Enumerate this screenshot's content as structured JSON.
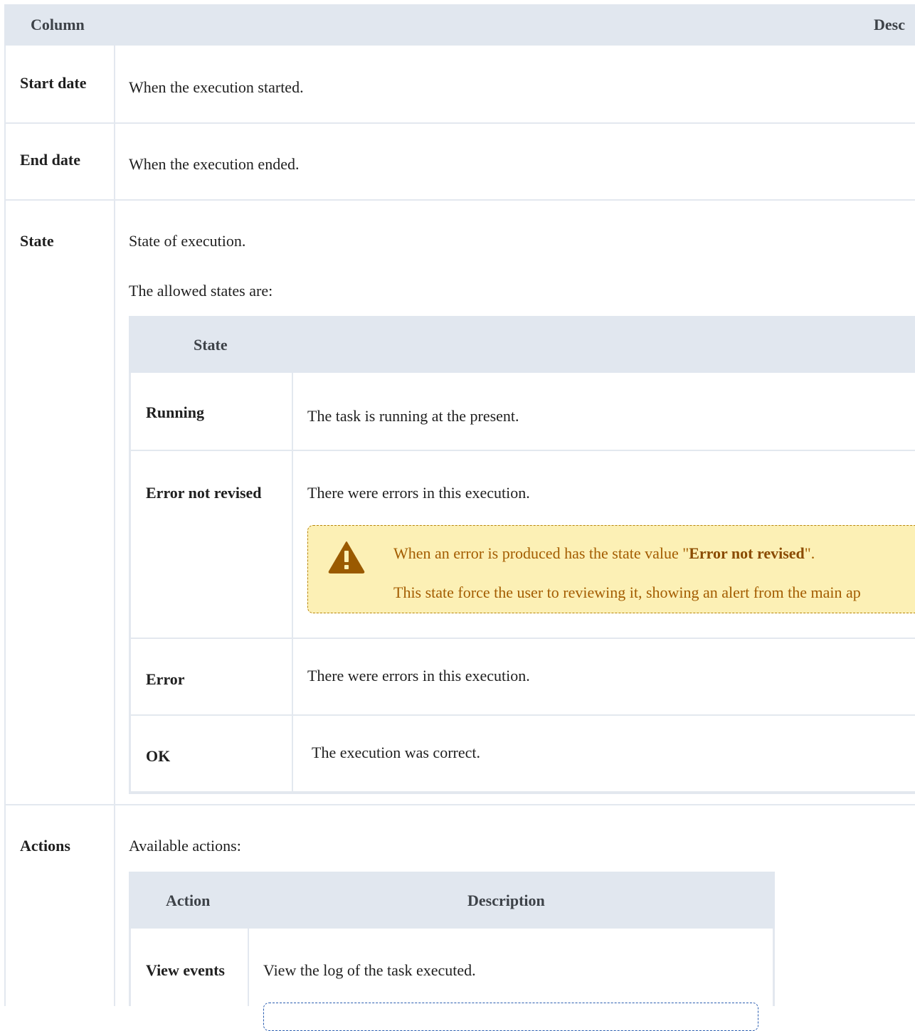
{
  "table": {
    "header": {
      "column": "Column",
      "description": "Desc"
    },
    "rows": {
      "start_date": {
        "label": "Start date",
        "text": "When the execution started."
      },
      "end_date": {
        "label": "End date",
        "text": "When the execution ended."
      },
      "state": {
        "label": "State",
        "text": "State of execution.",
        "allowed_text": "The allowed states are:",
        "sub_header": "State",
        "states": [
          {
            "label": "Running",
            "text": "The task is running at the present."
          },
          {
            "label": "Error not revised",
            "text": "There were errors in this execution.",
            "warning": {
              "line1_before": "When an error is produced has the state value \"",
              "line1_bold": "Error not revised",
              "line1_after": "\".",
              "line2": "This state force the user to reviewing it, showing an alert from the main ap"
            }
          },
          {
            "label": "Error",
            "text": "There were errors in this execution."
          },
          {
            "label": "OK",
            "text": "The execution was correct."
          }
        ]
      },
      "actions": {
        "label": "Actions",
        "text": "Available actions:",
        "sub_header": {
          "action": "Action",
          "description": "Description"
        },
        "items": [
          {
            "label": "View events",
            "text": "View the log of the task executed."
          }
        ]
      }
    }
  },
  "colors": {
    "header_bg": "#e1e7ef",
    "warning_bg": "#fcf0b5",
    "warning_icon": "#9a5a00"
  }
}
